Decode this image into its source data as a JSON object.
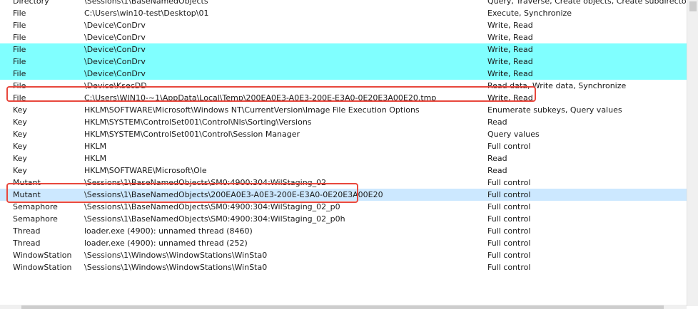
{
  "rows": [
    {
      "type": "Directory",
      "name": "\\Sessions\\1\\BaseNamedObjects",
      "access": "Query, Traverse, Create objects, Create subdirectories",
      "style": ""
    },
    {
      "type": "File",
      "name": "C:\\Users\\win10-test\\Desktop\\01",
      "access": "Execute, Synchronize",
      "style": ""
    },
    {
      "type": "File",
      "name": "\\Device\\ConDrv",
      "access": "Write, Read",
      "style": ""
    },
    {
      "type": "File",
      "name": "\\Device\\ConDrv",
      "access": "Write, Read",
      "style": ""
    },
    {
      "type": "File",
      "name": "\\Device\\ConDrv",
      "access": "Write, Read",
      "style": "cyan"
    },
    {
      "type": "File",
      "name": "\\Device\\ConDrv",
      "access": "Write, Read",
      "style": "cyan"
    },
    {
      "type": "File",
      "name": "\\Device\\ConDrv",
      "access": "Write, Read",
      "style": "cyan"
    },
    {
      "type": "File",
      "name": "\\Device\\KsecDD",
      "access": "Read data, Write data, Synchronize",
      "style": ""
    },
    {
      "type": "File",
      "name": "C:\\Users\\WIN10-~1\\AppData\\Local\\Temp\\200EA0E3-A0E3-200E-E3A0-0E20E3A00E20.tmp",
      "access": "Write, Read",
      "style": ""
    },
    {
      "type": "Key",
      "name": "HKLM\\SOFTWARE\\Microsoft\\Windows NT\\CurrentVersion\\Image File Execution Options",
      "access": "Enumerate subkeys, Query values",
      "style": ""
    },
    {
      "type": "Key",
      "name": "HKLM\\SYSTEM\\ControlSet001\\Control\\Nls\\Sorting\\Versions",
      "access": "Read",
      "style": ""
    },
    {
      "type": "Key",
      "name": "HKLM\\SYSTEM\\ControlSet001\\Control\\Session Manager",
      "access": "Query values",
      "style": ""
    },
    {
      "type": "Key",
      "name": "HKLM",
      "access": "Full control",
      "style": ""
    },
    {
      "type": "Key",
      "name": "HKLM",
      "access": "Read",
      "style": ""
    },
    {
      "type": "Key",
      "name": "HKLM\\SOFTWARE\\Microsoft\\Ole",
      "access": "Read",
      "style": ""
    },
    {
      "type": "Mutant",
      "name": "\\Sessions\\1\\BaseNamedObjects\\SM0:4900:304:WilStaging_02",
      "access": "Full control",
      "style": ""
    },
    {
      "type": "Mutant",
      "name": "\\Sessions\\1\\BaseNamedObjects\\200EA0E3-A0E3-200E-E3A0-0E20E3A00E20",
      "access": "Full control",
      "style": "selected"
    },
    {
      "type": "Semaphore",
      "name": "\\Sessions\\1\\BaseNamedObjects\\SM0:4900:304:WilStaging_02_p0",
      "access": "Full control",
      "style": ""
    },
    {
      "type": "Semaphore",
      "name": "\\Sessions\\1\\BaseNamedObjects\\SM0:4900:304:WilStaging_02_p0h",
      "access": "Full control",
      "style": ""
    },
    {
      "type": "Thread",
      "name": "loader.exe (4900): unnamed thread (8460)",
      "access": "Full control",
      "style": ""
    },
    {
      "type": "Thread",
      "name": "loader.exe (4900): unnamed thread (252)",
      "access": "Full control",
      "style": ""
    },
    {
      "type": "WindowStation",
      "name": "\\Sessions\\1\\Windows\\WindowStations\\WinSta0",
      "access": "Full control",
      "style": ""
    },
    {
      "type": "WindowStation",
      "name": "\\Sessions\\1\\Windows\\WindowStations\\WinSta0",
      "access": "Full control",
      "style": ""
    }
  ],
  "colors": {
    "highlight_cyan": "#80ffff",
    "selected_row": "#cce8ff",
    "annotation_red": "#e8473c"
  }
}
